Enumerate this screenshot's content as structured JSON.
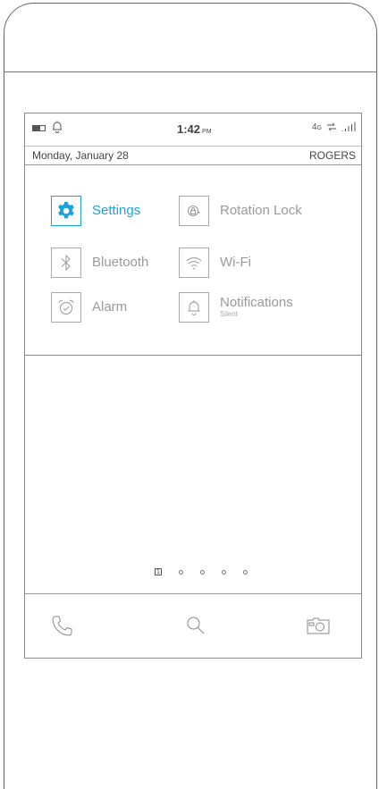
{
  "status_bar": {
    "time": "1:42",
    "ampm": "PM",
    "network": "4",
    "network_suffix": "G",
    "icons": [
      "battery-icon",
      "bell-icon",
      "data-arrows-icon",
      "signal-icon"
    ]
  },
  "date_bar": {
    "date": "Monday, January 28",
    "carrier": "ROGERS"
  },
  "quick_settings": [
    {
      "label": "Settings",
      "icon": "gear-icon",
      "active": true
    },
    {
      "label": "Rotation Lock",
      "icon": "rotation-lock-icon",
      "active": false
    },
    {
      "label": "Bluetooth",
      "icon": "bluetooth-icon",
      "active": false
    },
    {
      "label": "Wi-Fi",
      "icon": "wifi-icon",
      "active": false
    },
    {
      "label": "Alarm",
      "icon": "alarm-icon",
      "active": false
    },
    {
      "label": "Notifications",
      "sublabel": "Silent",
      "icon": "bell-icon",
      "active": false
    }
  ],
  "page_indicator": {
    "current": "1",
    "total_pages": 5
  },
  "dock": {
    "items": [
      "phone-icon",
      "search-icon",
      "camera-icon"
    ]
  },
  "colors": {
    "accent": "#1aa3d9",
    "line": "#666666",
    "text_muted": "#9a9a9a"
  }
}
